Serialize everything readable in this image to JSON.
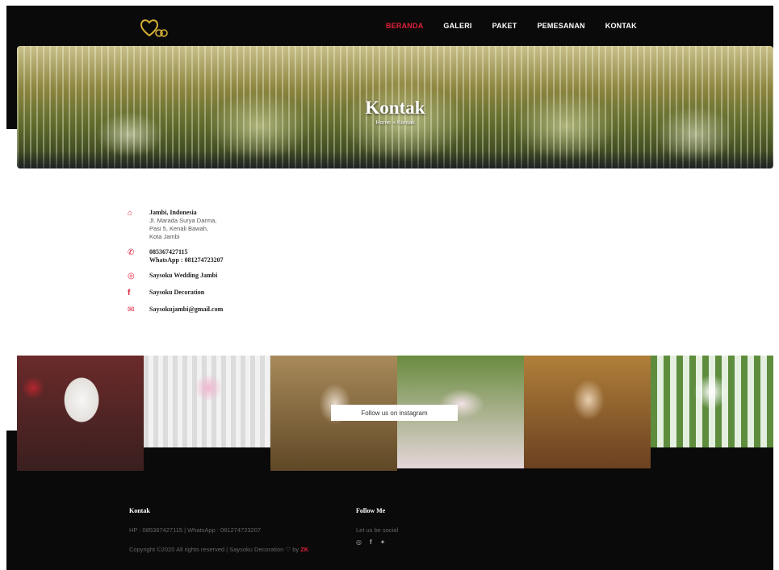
{
  "nav": {
    "items": [
      {
        "label": "BERANDA",
        "active": true
      },
      {
        "label": "GALERI",
        "active": false
      },
      {
        "label": "PAKET",
        "active": false
      },
      {
        "label": "PEMESANAN",
        "active": false
      },
      {
        "label": "KONTAK",
        "active": false
      }
    ]
  },
  "hero": {
    "title": "Kontak",
    "breadcrumb": "Home  »  Kontak"
  },
  "contact": {
    "address_title": "Jambi, Indonesia",
    "address_lines": [
      "Jl. Marada Surya Darma,",
      "Pasi 5, Kenali Bawah,",
      "Kota Jambi"
    ],
    "phone": "085367427115",
    "whatsapp": "WhatsApp : 081274723207",
    "instagram": "Saysoku Wedding Jambi",
    "facebook": "Saysoku Decoration",
    "email": "Saysokujambi@gmail.com"
  },
  "instagram": {
    "button_label": "Follow us on instagram"
  },
  "footer": {
    "col1_title": "Kontak",
    "contact_line": "HP : 085367427115 | WhatsApp : 081274723207",
    "copyright_pre": "Copyright ©2020 All rights reserved | Saysoku Decoration ",
    "heart": "♡",
    "by_text": " by ",
    "author": "ZK",
    "col2_title": "Follow Me",
    "social_text": "Let us be social"
  },
  "colors": {
    "accent": "#e0203a",
    "navbar_bg": "#0a0a0a"
  }
}
